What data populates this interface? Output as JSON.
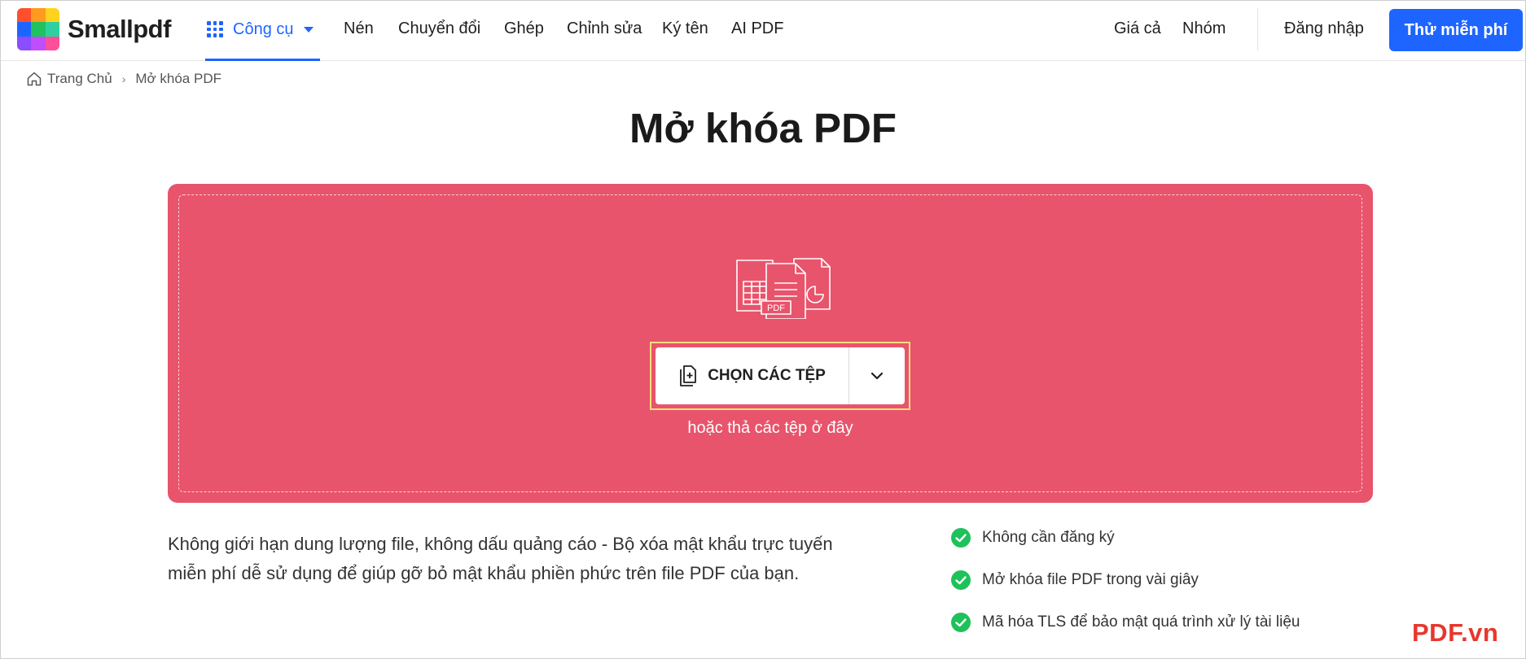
{
  "header": {
    "logo_text": "Smallpdf",
    "tools_label": "Công cụ",
    "nav": [
      "Nén",
      "Chuyển đổi",
      "Ghép",
      "Chỉnh sửa",
      "Ký tên",
      "AI PDF"
    ],
    "right_nav": [
      "Giá cả",
      "Nhóm"
    ],
    "login_label": "Đăng nhập",
    "try_label": "Thử miễn phí"
  },
  "breadcrumb": {
    "home": "Trang Chủ",
    "separator": "›",
    "current": "Mở khóa PDF"
  },
  "page_title": "Mở khóa PDF",
  "dropzone": {
    "choose_label": "CHỌN CÁC TỆP",
    "hint": "hoặc thả các tệp ở đây",
    "illustration_badge": "PDF"
  },
  "description": "Không giới hạn dung lượng file, không dấu quảng cáo - Bộ xóa mật khẩu trực tuyến miễn phí dễ sử dụng để giúp gỡ bỏ mật khẩu phiền phức trên file PDF của bạn.",
  "features": [
    "Không cần đăng ký",
    "Mở khóa file PDF trong vài giây",
    "Mã hóa TLS để bảo mật quá trình xử lý tài liệu"
  ],
  "watermark": "PDF.vn",
  "colors": {
    "accent_blue": "#1e65ff",
    "dropzone_red": "#e8546b",
    "check_green": "#1fc15a",
    "highlight_yellow": "#f6df7e",
    "watermark_red": "#e8362c"
  }
}
